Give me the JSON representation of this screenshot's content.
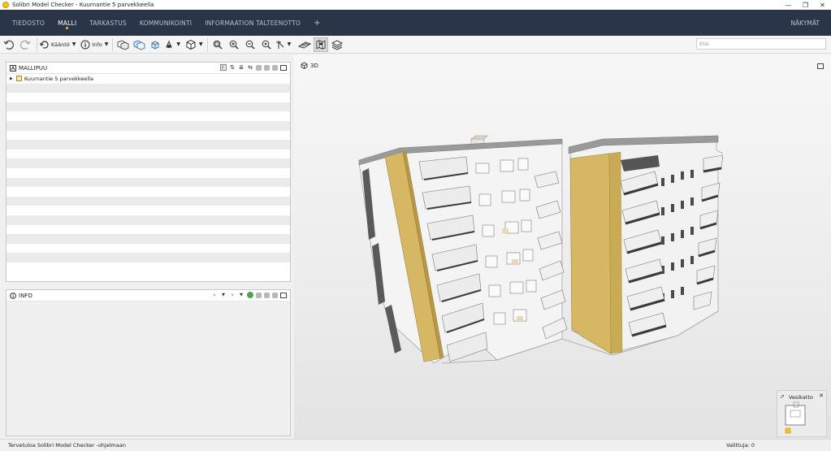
{
  "window": {
    "title": "Solibri Model Checker - Kuurnantie 5 parvekkeella",
    "controls": [
      "—",
      "❐",
      "✕"
    ]
  },
  "menubar": {
    "items": [
      "TIEDOSTO",
      "MALLI",
      "TARKASTUS",
      "KOMMUNIKOINTI",
      "INFORMAATION TALTEENOTTO"
    ],
    "active": "MALLI",
    "add": "+",
    "right": "NÄKYMÄT"
  },
  "toolbar": {
    "kaanto_label": "Kääntö",
    "info_label": "Info",
    "search_placeholder": "Etsi"
  },
  "tree_panel": {
    "title": "MALLIPUU",
    "root_item": "Kuurnantie 5 parvekkeella"
  },
  "info_panel": {
    "title": "INFO"
  },
  "viewport": {
    "label": "3D",
    "minimap_title": "Vesikatto"
  },
  "status": {
    "left": "Tervetuloa Solibri Model Checker -ohjelmaan",
    "right": "Valittuja: 0"
  },
  "colors": {
    "menubar": "#2a3548",
    "accent": "#f5c518",
    "facade_yellow": "#d6b864"
  }
}
